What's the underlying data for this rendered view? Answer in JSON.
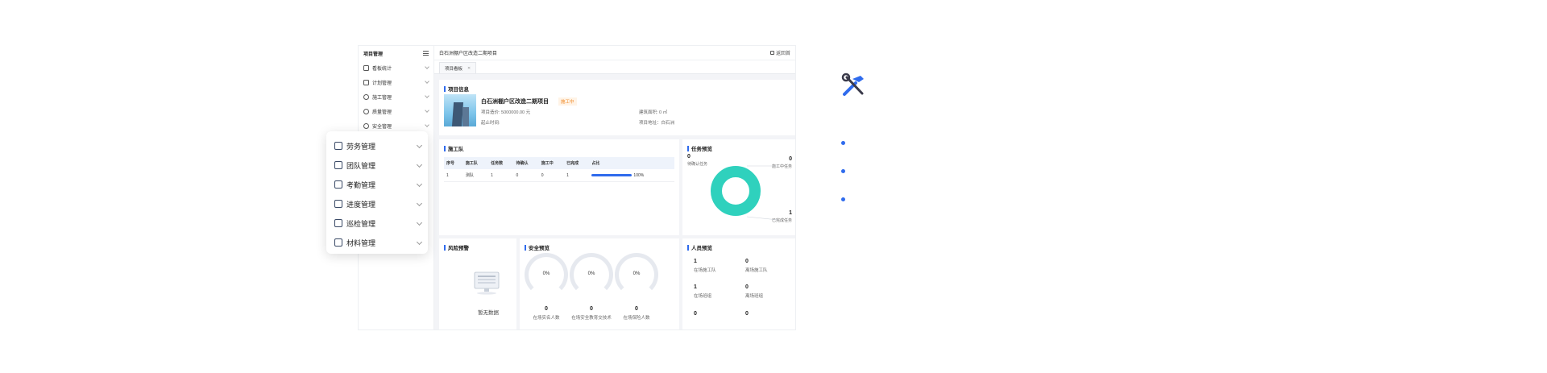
{
  "sidebar": {
    "title": "项目管理",
    "items": [
      {
        "label": "看板统计",
        "icon": "dashboard-icon"
      },
      {
        "label": "计划管理",
        "icon": "plan-icon"
      },
      {
        "label": "施工管理",
        "icon": "construction-icon"
      },
      {
        "label": "质量管理",
        "icon": "quality-icon"
      },
      {
        "label": "安全管理",
        "icon": "safety-icon"
      }
    ]
  },
  "header": {
    "project_title": "白石洲棚户区改造二期项目",
    "back_label": "返回首"
  },
  "tabs": [
    {
      "label": "项目看板"
    }
  ],
  "project_info": {
    "title": "项目信息",
    "name": "白石洲棚户区改造二期项目",
    "status": "施工中",
    "cost": "项目造价: 5000000.00 元",
    "area": "建筑面积: 0 ㎡",
    "period": "起止时间:",
    "address": "项目地址：白石洲"
  },
  "team": {
    "title": "施工队",
    "columns": [
      "序号",
      "施工队",
      "任务数",
      "待确认",
      "施工中",
      "已完成",
      "占比"
    ],
    "rows": [
      {
        "no": "1",
        "name": "测队",
        "tasks": "1",
        "pending": "0",
        "ongoing": "0",
        "done": "1",
        "ratio": "100%",
        "ratio_value": 1.0
      }
    ]
  },
  "task_overview": {
    "title": "任务预览",
    "pending_num": "0",
    "pending_label": "待确认任务",
    "ongoing_num": "0",
    "ongoing_label": "施工中任务",
    "done_num": "1",
    "done_label": "已完成任务",
    "donut_color": "#2fd1bd"
  },
  "risk": {
    "title": "风险预警",
    "empty_text": "暂无数据"
  },
  "safety": {
    "title": "安全预览",
    "gauges": [
      {
        "value": "0%",
        "num": "0",
        "label": "在场实名人数"
      },
      {
        "value": "0%",
        "num": "0",
        "label": "在场安全教育交技术"
      },
      {
        "value": "0%",
        "num": "0",
        "label": "在场保险人数"
      }
    ]
  },
  "staff": {
    "title": "人员预览",
    "items": [
      {
        "num": "1",
        "label": "在场施工队"
      },
      {
        "num": "0",
        "label": "离场施工队"
      },
      {
        "num": "1",
        "label": "在场班组"
      },
      {
        "num": "0",
        "label": "离场班组"
      },
      {
        "num": "0",
        "label": ""
      },
      {
        "num": "0",
        "label": ""
      }
    ]
  },
  "popup_menu": {
    "items": [
      {
        "label": "劳务管理",
        "icon": "labor-icon"
      },
      {
        "label": "团队管理",
        "icon": "team-icon"
      },
      {
        "label": "考勤管理",
        "icon": "calendar-icon"
      },
      {
        "label": "进度管理",
        "icon": "progress-icon"
      },
      {
        "label": "巡检管理",
        "icon": "inspection-icon"
      },
      {
        "label": "材料管理",
        "icon": "material-icon"
      }
    ]
  },
  "accent_color": "#2f6bed"
}
